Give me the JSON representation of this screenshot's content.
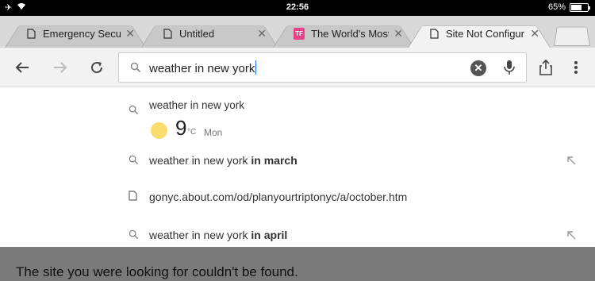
{
  "status": {
    "time": "22:56",
    "battery_percent": "65%",
    "battery_level": 0.65
  },
  "tabs": [
    {
      "title": "Emergency Secur",
      "icon": "page-icon",
      "active": false
    },
    {
      "title": "Untitled",
      "icon": "page-icon",
      "active": false
    },
    {
      "title": "The World's Most",
      "icon": "tf-favicon",
      "badge": "TF",
      "active": false
    },
    {
      "title": "Site Not Configur",
      "icon": "page-icon",
      "active": true
    }
  ],
  "toolbar": {
    "back_icon": "back-arrow-icon",
    "forward_icon": "forward-arrow-icon",
    "reload_icon": "reload-icon",
    "share_icon": "share-icon",
    "menu_icon": "more-vert-icon"
  },
  "omnibox": {
    "value": "weather in new york"
  },
  "suggestions": {
    "weather": {
      "query": "weather in new york",
      "temperature": "9",
      "unit": "°C",
      "day": "Mon"
    },
    "items": [
      {
        "prefix": "weather in new york ",
        "bold": "in march",
        "type": "search"
      },
      {
        "prefix": "gonyc.about.com/od/planyourtriptonyc/a/october.htm",
        "bold": "",
        "type": "page"
      },
      {
        "prefix": "weather in new york ",
        "bold": "in april",
        "type": "search"
      }
    ]
  },
  "page": {
    "message": "The site you were looking for couldn't be found."
  },
  "colors": {
    "sun": "#fddc6e",
    "tf_badge": "#e8418a",
    "cursor": "#1a73e8"
  }
}
